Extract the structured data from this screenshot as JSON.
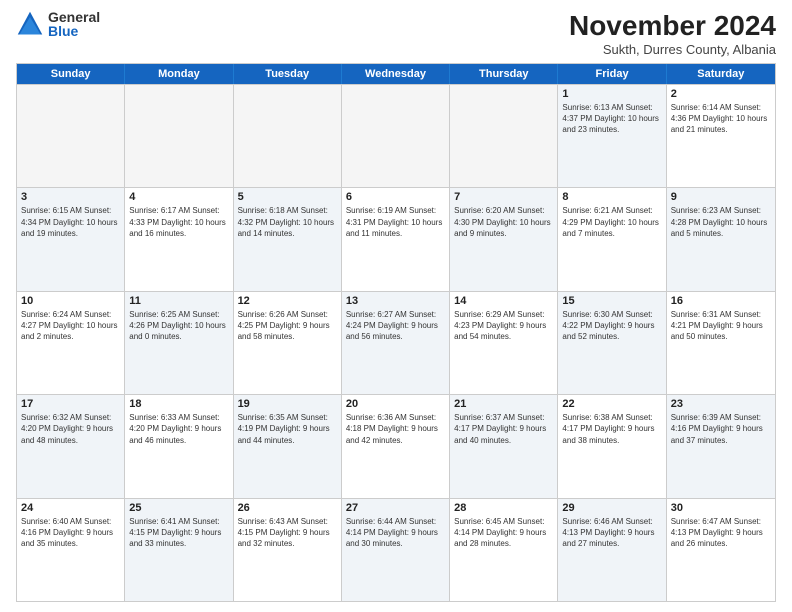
{
  "logo": {
    "general": "General",
    "blue": "Blue"
  },
  "header": {
    "month": "November 2024",
    "location": "Sukth, Durres County, Albania"
  },
  "weekdays": [
    "Sunday",
    "Monday",
    "Tuesday",
    "Wednesday",
    "Thursday",
    "Friday",
    "Saturday"
  ],
  "rows": [
    [
      {
        "day": "",
        "info": "",
        "empty": true
      },
      {
        "day": "",
        "info": "",
        "empty": true
      },
      {
        "day": "",
        "info": "",
        "empty": true
      },
      {
        "day": "",
        "info": "",
        "empty": true
      },
      {
        "day": "",
        "info": "",
        "empty": true
      },
      {
        "day": "1",
        "info": "Sunrise: 6:13 AM\nSunset: 4:37 PM\nDaylight: 10 hours\nand 23 minutes.",
        "empty": false,
        "shaded": true
      },
      {
        "day": "2",
        "info": "Sunrise: 6:14 AM\nSunset: 4:36 PM\nDaylight: 10 hours\nand 21 minutes.",
        "empty": false,
        "shaded": false
      }
    ],
    [
      {
        "day": "3",
        "info": "Sunrise: 6:15 AM\nSunset: 4:34 PM\nDaylight: 10 hours\nand 19 minutes.",
        "empty": false,
        "shaded": true
      },
      {
        "day": "4",
        "info": "Sunrise: 6:17 AM\nSunset: 4:33 PM\nDaylight: 10 hours\nand 16 minutes.",
        "empty": false,
        "shaded": false
      },
      {
        "day": "5",
        "info": "Sunrise: 6:18 AM\nSunset: 4:32 PM\nDaylight: 10 hours\nand 14 minutes.",
        "empty": false,
        "shaded": true
      },
      {
        "day": "6",
        "info": "Sunrise: 6:19 AM\nSunset: 4:31 PM\nDaylight: 10 hours\nand 11 minutes.",
        "empty": false,
        "shaded": false
      },
      {
        "day": "7",
        "info": "Sunrise: 6:20 AM\nSunset: 4:30 PM\nDaylight: 10 hours\nand 9 minutes.",
        "empty": false,
        "shaded": true
      },
      {
        "day": "8",
        "info": "Sunrise: 6:21 AM\nSunset: 4:29 PM\nDaylight: 10 hours\nand 7 minutes.",
        "empty": false,
        "shaded": false
      },
      {
        "day": "9",
        "info": "Sunrise: 6:23 AM\nSunset: 4:28 PM\nDaylight: 10 hours\nand 5 minutes.",
        "empty": false,
        "shaded": true
      }
    ],
    [
      {
        "day": "10",
        "info": "Sunrise: 6:24 AM\nSunset: 4:27 PM\nDaylight: 10 hours\nand 2 minutes.",
        "empty": false,
        "shaded": false
      },
      {
        "day": "11",
        "info": "Sunrise: 6:25 AM\nSunset: 4:26 PM\nDaylight: 10 hours\nand 0 minutes.",
        "empty": false,
        "shaded": true
      },
      {
        "day": "12",
        "info": "Sunrise: 6:26 AM\nSunset: 4:25 PM\nDaylight: 9 hours\nand 58 minutes.",
        "empty": false,
        "shaded": false
      },
      {
        "day": "13",
        "info": "Sunrise: 6:27 AM\nSunset: 4:24 PM\nDaylight: 9 hours\nand 56 minutes.",
        "empty": false,
        "shaded": true
      },
      {
        "day": "14",
        "info": "Sunrise: 6:29 AM\nSunset: 4:23 PM\nDaylight: 9 hours\nand 54 minutes.",
        "empty": false,
        "shaded": false
      },
      {
        "day": "15",
        "info": "Sunrise: 6:30 AM\nSunset: 4:22 PM\nDaylight: 9 hours\nand 52 minutes.",
        "empty": false,
        "shaded": true
      },
      {
        "day": "16",
        "info": "Sunrise: 6:31 AM\nSunset: 4:21 PM\nDaylight: 9 hours\nand 50 minutes.",
        "empty": false,
        "shaded": false
      }
    ],
    [
      {
        "day": "17",
        "info": "Sunrise: 6:32 AM\nSunset: 4:20 PM\nDaylight: 9 hours\nand 48 minutes.",
        "empty": false,
        "shaded": true
      },
      {
        "day": "18",
        "info": "Sunrise: 6:33 AM\nSunset: 4:20 PM\nDaylight: 9 hours\nand 46 minutes.",
        "empty": false,
        "shaded": false
      },
      {
        "day": "19",
        "info": "Sunrise: 6:35 AM\nSunset: 4:19 PM\nDaylight: 9 hours\nand 44 minutes.",
        "empty": false,
        "shaded": true
      },
      {
        "day": "20",
        "info": "Sunrise: 6:36 AM\nSunset: 4:18 PM\nDaylight: 9 hours\nand 42 minutes.",
        "empty": false,
        "shaded": false
      },
      {
        "day": "21",
        "info": "Sunrise: 6:37 AM\nSunset: 4:17 PM\nDaylight: 9 hours\nand 40 minutes.",
        "empty": false,
        "shaded": true
      },
      {
        "day": "22",
        "info": "Sunrise: 6:38 AM\nSunset: 4:17 PM\nDaylight: 9 hours\nand 38 minutes.",
        "empty": false,
        "shaded": false
      },
      {
        "day": "23",
        "info": "Sunrise: 6:39 AM\nSunset: 4:16 PM\nDaylight: 9 hours\nand 37 minutes.",
        "empty": false,
        "shaded": true
      }
    ],
    [
      {
        "day": "24",
        "info": "Sunrise: 6:40 AM\nSunset: 4:16 PM\nDaylight: 9 hours\nand 35 minutes.",
        "empty": false,
        "shaded": false
      },
      {
        "day": "25",
        "info": "Sunrise: 6:41 AM\nSunset: 4:15 PM\nDaylight: 9 hours\nand 33 minutes.",
        "empty": false,
        "shaded": true
      },
      {
        "day": "26",
        "info": "Sunrise: 6:43 AM\nSunset: 4:15 PM\nDaylight: 9 hours\nand 32 minutes.",
        "empty": false,
        "shaded": false
      },
      {
        "day": "27",
        "info": "Sunrise: 6:44 AM\nSunset: 4:14 PM\nDaylight: 9 hours\nand 30 minutes.",
        "empty": false,
        "shaded": true
      },
      {
        "day": "28",
        "info": "Sunrise: 6:45 AM\nSunset: 4:14 PM\nDaylight: 9 hours\nand 28 minutes.",
        "empty": false,
        "shaded": false
      },
      {
        "day": "29",
        "info": "Sunrise: 6:46 AM\nSunset: 4:13 PM\nDaylight: 9 hours\nand 27 minutes.",
        "empty": false,
        "shaded": true
      },
      {
        "day": "30",
        "info": "Sunrise: 6:47 AM\nSunset: 4:13 PM\nDaylight: 9 hours\nand 26 minutes.",
        "empty": false,
        "shaded": false
      }
    ]
  ]
}
